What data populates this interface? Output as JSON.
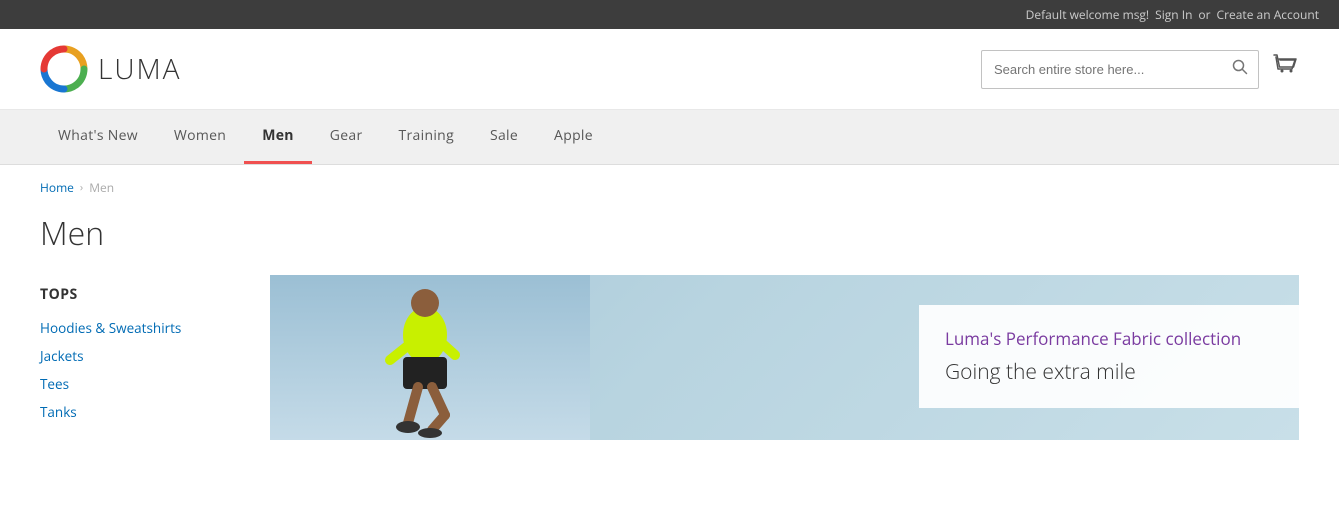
{
  "topbar": {
    "welcome": "Default welcome msg!",
    "signin": "Sign In",
    "or": "or",
    "create_account": "Create an Account"
  },
  "header": {
    "logo_text": "LUMA",
    "search_placeholder": "Search entire store here...",
    "search_button_icon": "🔍",
    "cart_icon": "🛒"
  },
  "nav": {
    "items": [
      {
        "label": "What's New",
        "active": false
      },
      {
        "label": "Women",
        "active": false
      },
      {
        "label": "Men",
        "active": true
      },
      {
        "label": "Gear",
        "active": false
      },
      {
        "label": "Training",
        "active": false
      },
      {
        "label": "Sale",
        "active": false
      },
      {
        "label": "Apple",
        "active": false
      }
    ]
  },
  "breadcrumb": {
    "home": "Home",
    "current": "Men"
  },
  "page_title": "Men",
  "sidebar": {
    "section_title": "TOPS",
    "items": [
      {
        "label": "Hoodies & Sweatshirts"
      },
      {
        "label": "Jackets"
      },
      {
        "label": "Tees"
      },
      {
        "label": "Tanks"
      }
    ]
  },
  "hero": {
    "title": "Luma's Performance Fabric collection",
    "subtitle": "Going the extra mile"
  }
}
